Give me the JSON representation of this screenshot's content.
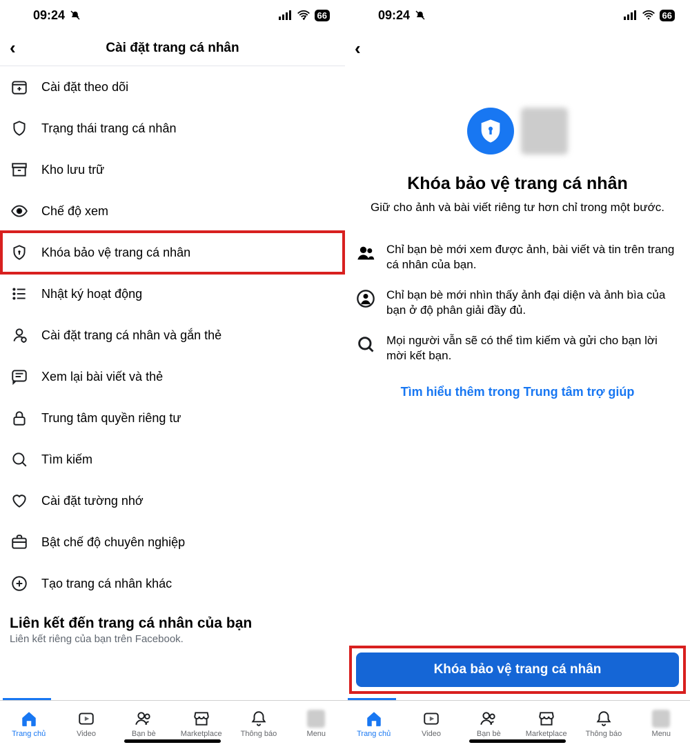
{
  "status": {
    "time": "09:24",
    "battery": "66"
  },
  "left": {
    "title": "Cài đặt trang cá nhân",
    "items": [
      "Cài đặt theo dõi",
      "Trạng thái trang cá nhân",
      "Kho lưu trữ",
      "Chế độ xem",
      "Khóa bảo vệ trang cá nhân",
      "Nhật ký hoạt động",
      "Cài đặt trang cá nhân và gắn thẻ",
      "Xem lại bài viết và thẻ",
      "Trung tâm quyền riêng tư",
      "Tìm kiếm",
      "Cài đặt tường nhớ",
      "Bật chế độ chuyên nghiệp",
      "Tạo trang cá nhân khác"
    ],
    "section_title": "Liên kết đến trang cá nhân của bạn",
    "section_sub": "Liên kết riêng của bạn trên Facebook."
  },
  "right": {
    "heading": "Khóa bảo vệ trang cá nhân",
    "desc": "Giữ cho ảnh và bài viết riêng tư hơn chỉ trong một bước.",
    "bullets": [
      "Chỉ bạn bè mới xem được ảnh, bài viết và tin trên trang cá nhân của bạn.",
      "Chỉ bạn bè mới nhìn thấy ảnh đại diện và ảnh bìa của bạn ở độ phân giải đầy đủ.",
      "Mọi người vẫn sẽ có thể tìm kiếm và gửi cho bạn lời mời kết bạn."
    ],
    "learn": "Tìm hiểu thêm trong Trung tâm trợ giúp",
    "cta": "Khóa bảo vệ trang cá nhân"
  },
  "tabs": [
    "Trang chủ",
    "Video",
    "Bạn bè",
    "Marketplace",
    "Thông báo",
    "Menu"
  ]
}
